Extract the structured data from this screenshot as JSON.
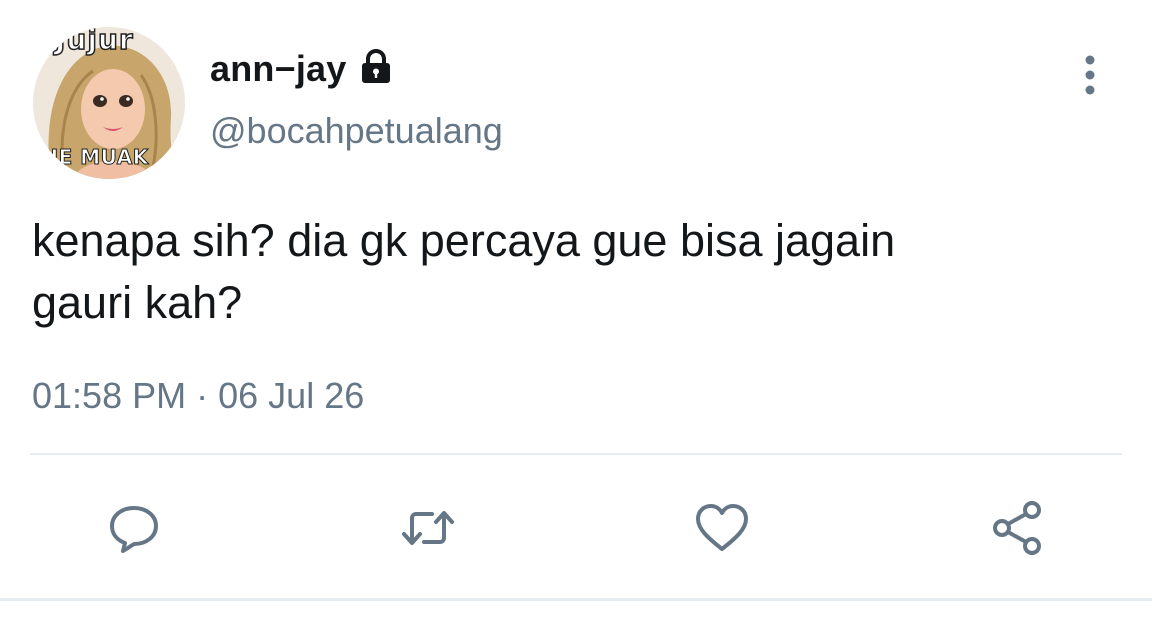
{
  "user": {
    "display_name": "ann−jay",
    "handle": "@bocahpetualang",
    "protected_icon": "lock-icon",
    "avatar_icon": "doll-avatar",
    "avatar_top_text": "Jujur",
    "avatar_bottom_text": "GUE MUAK"
  },
  "tweet": {
    "text_line1": "kenapa sih? dia gk percaya gue bisa jagain",
    "text_line2": "gauri kah?",
    "time": "01:58 PM",
    "separator": "·",
    "date": "06 Jul 26"
  },
  "actions": [
    {
      "name": "reply",
      "icon": "comment-icon"
    },
    {
      "name": "retweet",
      "icon": "retweet-icon"
    },
    {
      "name": "like",
      "icon": "heart-icon"
    },
    {
      "name": "share",
      "icon": "share-icon"
    }
  ],
  "menu_icon": "more-vertical-icon",
  "colors": {
    "text": "#14171a",
    "secondary": "#657786",
    "divider": "#e6ecf0"
  }
}
